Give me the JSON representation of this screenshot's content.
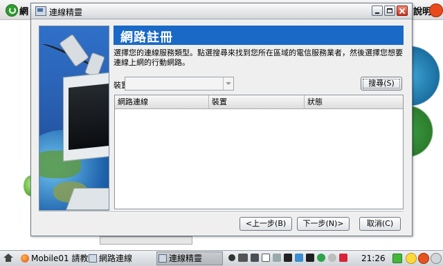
{
  "background_app": {
    "title": "網",
    "help_label": "說明"
  },
  "dialog": {
    "title": "連線精靈",
    "header_title": "網路註冊",
    "description": "選擇您的連線服務類型。點選搜尋來找到您所在區域的電信服務業者，然後選擇您想要連線上網的行動網路。",
    "device_label": "裝置",
    "device_value": "",
    "search_button": "搜尋(S)",
    "table": {
      "columns": [
        "網路連線",
        "裝置",
        "狀態"
      ],
      "rows": []
    },
    "back_button": "<上一步(B)",
    "next_button": "下一步(N)>",
    "cancel_button": "取消(C)"
  },
  "taskbar": {
    "tasks": [
      {
        "label": "Mobile01 請教",
        "icon": "firefox-icon"
      },
      {
        "label": "網路連線",
        "icon": "network-window-icon"
      },
      {
        "label": "連線精靈",
        "icon": "network-window-icon",
        "active": true
      }
    ],
    "clock": "21:26",
    "tray_icons": [
      "wifi-icon",
      "battery-icon",
      "network-icon",
      "clipboard-icon",
      "font-icon",
      "volume-icon",
      "mute-icon",
      "chat-icon",
      "globe-icon",
      "shield-icon",
      "hardware-icon",
      "smile-icon",
      "power-icon",
      "exit-icon"
    ]
  },
  "colors": {
    "header_banner": "#1a69c7",
    "taskbar_bg": "#cfd3d8",
    "close_button": "#c8311c"
  }
}
